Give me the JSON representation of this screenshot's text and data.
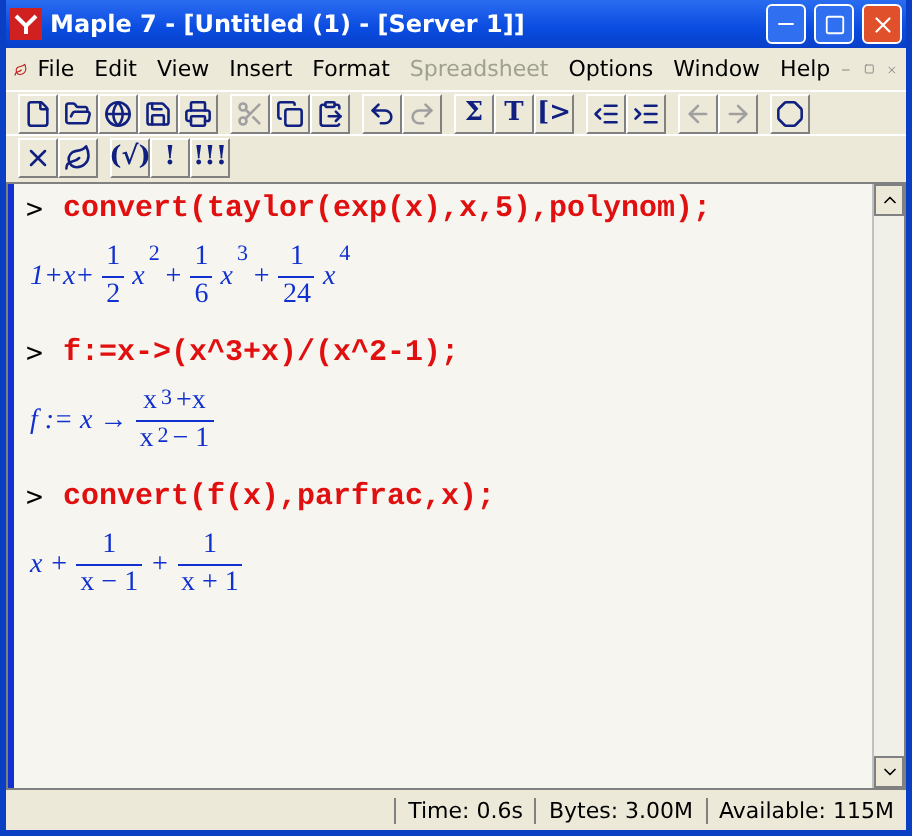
{
  "window": {
    "title": "Maple 7  - [Untitled (1) - [Server 1]]"
  },
  "menu": [
    {
      "label": "File",
      "disabled": false
    },
    {
      "label": "Edit",
      "disabled": false
    },
    {
      "label": "View",
      "disabled": false
    },
    {
      "label": "Insert",
      "disabled": false
    },
    {
      "label": "Format",
      "disabled": false
    },
    {
      "label": "Spreadsheet",
      "disabled": true
    },
    {
      "label": "Options",
      "disabled": false
    },
    {
      "label": "Window",
      "disabled": false
    },
    {
      "label": "Help",
      "disabled": false
    }
  ],
  "toolbar": [
    [
      {
        "disabled": false
      },
      {
        "disabled": false
      },
      {
        "disabled": false
      },
      {
        "disabled": false
      },
      {
        "disabled": false
      }
    ],
    [
      {
        "disabled": true
      },
      {
        "disabled": false
      },
      {
        "disabled": false
      }
    ],
    [
      {
        "disabled": false
      },
      {
        "disabled": true
      }
    ],
    [
      {
        "disabled": false,
        "text": "Σ"
      },
      {
        "disabled": false,
        "text": "T"
      },
      {
        "disabled": false,
        "text": "[>"
      }
    ],
    [
      {
        "disabled": false
      },
      {
        "disabled": false
      }
    ],
    [
      {
        "disabled": true
      },
      {
        "disabled": true
      }
    ],
    [
      {
        "disabled": false
      }
    ]
  ],
  "toolbar2": [
    [
      {
        "disabled": false
      },
      {
        "disabled": false
      }
    ],
    [
      {
        "disabled": false,
        "text": "(√)"
      },
      {
        "disabled": false,
        "text": "!"
      },
      {
        "disabled": false,
        "text": "!!!"
      }
    ]
  ],
  "worksheet": [
    {
      "kind": "input",
      "prompt": ">",
      "command": "convert(taylor(exp(x),x,5),polynom);"
    },
    {
      "kind": "output",
      "terms": [
        {
          "kind": "text",
          "text": "1+x+"
        },
        {
          "kind": "frac",
          "num": [
            {
              "kind": "text",
              "text": "1"
            }
          ],
          "den": [
            {
              "kind": "text",
              "text": "2"
            }
          ]
        },
        {
          "kind": "text",
          "text": "x"
        },
        {
          "kind": "sup",
          "text": "2"
        },
        {
          "kind": "text",
          "text": "+"
        },
        {
          "kind": "frac",
          "num": [
            {
              "kind": "text",
              "text": "1"
            }
          ],
          "den": [
            {
              "kind": "text",
              "text": "6"
            }
          ]
        },
        {
          "kind": "text",
          "text": "x"
        },
        {
          "kind": "sup",
          "text": "3"
        },
        {
          "kind": "text",
          "text": "+"
        },
        {
          "kind": "frac",
          "num": [
            {
              "kind": "text",
              "text": "1"
            }
          ],
          "den": [
            {
              "kind": "text",
              "text": "24"
            }
          ]
        },
        {
          "kind": "text",
          "text": "x"
        },
        {
          "kind": "sup",
          "text": "4"
        }
      ]
    },
    {
      "kind": "input",
      "prompt": ">",
      "command": "f:=x->(x^3+x)/(x^2-1);"
    },
    {
      "kind": "output",
      "terms": [
        {
          "kind": "text",
          "text": "f := x →"
        },
        {
          "kind": "frac",
          "num": [
            {
              "kind": "text",
              "text": "x"
            },
            {
              "kind": "sup",
              "text": "3"
            },
            {
              "kind": "text",
              "text": "+x"
            }
          ],
          "den": [
            {
              "kind": "text",
              "text": "x"
            },
            {
              "kind": "sup",
              "text": "2"
            },
            {
              "kind": "text",
              "text": "− 1"
            }
          ]
        }
      ]
    },
    {
      "kind": "input",
      "prompt": ">",
      "command": "convert(f(x),parfrac,x);"
    },
    {
      "kind": "output",
      "terms": [
        {
          "kind": "text",
          "text": "x +"
        },
        {
          "kind": "frac",
          "num": [
            {
              "kind": "text",
              "text": "1"
            }
          ],
          "den": [
            {
              "kind": "text",
              "text": "x − 1"
            }
          ]
        },
        {
          "kind": "text",
          "text": "+"
        },
        {
          "kind": "frac",
          "num": [
            {
              "kind": "text",
              "text": "1"
            }
          ],
          "den": [
            {
              "kind": "text",
              "text": "x + 1"
            }
          ]
        }
      ]
    }
  ],
  "status_bar": [
    "Time: 0.6s",
    "Bytes: 3.00M",
    "Available: 115M"
  ]
}
